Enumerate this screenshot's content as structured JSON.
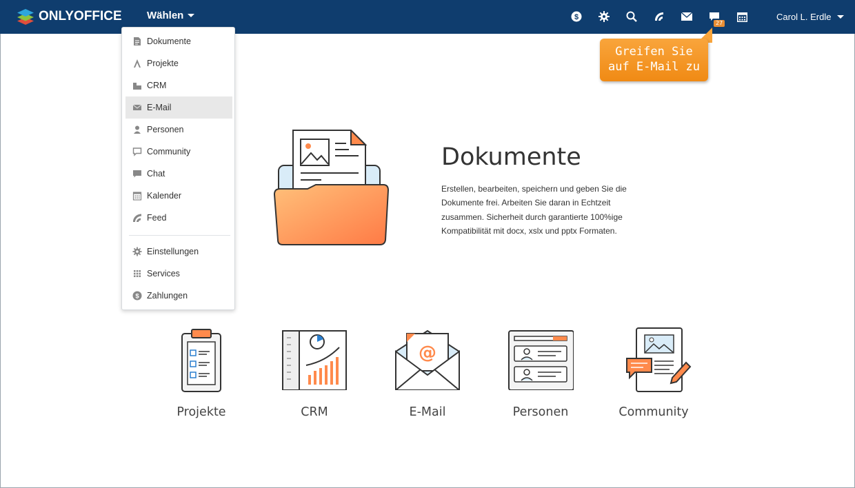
{
  "header": {
    "logo_text": "ONLYOFFICE",
    "modules_label": "Wählen",
    "icons": [
      "dollar-icon",
      "gear-icon",
      "search-icon",
      "feed-icon",
      "mail-icon",
      "chat-icon",
      "calendar-icon"
    ],
    "chat_badge": "27",
    "user_name": "Carol L. Erdle",
    "background_color": "#0f3d6e"
  },
  "dropdown": {
    "items": [
      {
        "label": "Dokumente",
        "icon": "document-icon"
      },
      {
        "label": "Projekte",
        "icon": "projects-icon"
      },
      {
        "label": "CRM",
        "icon": "crm-icon"
      },
      {
        "label": "E-Mail",
        "icon": "mail-icon",
        "active": true
      },
      {
        "label": "Personen",
        "icon": "person-icon"
      },
      {
        "label": "Community",
        "icon": "community-icon"
      },
      {
        "label": "Chat",
        "icon": "chat-icon"
      },
      {
        "label": "Kalender",
        "icon": "calendar-icon"
      },
      {
        "label": "Feed",
        "icon": "feed-icon"
      }
    ],
    "secondary_items": [
      {
        "label": "Einstellungen",
        "icon": "gear-icon"
      },
      {
        "label": "Services",
        "icon": "grid-icon"
      },
      {
        "label": "Zahlungen",
        "icon": "dollar-icon"
      }
    ]
  },
  "tooltip": {
    "line1": "Greifen Sie",
    "line2": "auf E-Mail zu",
    "color": "#f7941d"
  },
  "hero": {
    "title": "Dokumente",
    "description": "Erstellen, bearbeiten, speichern und geben Sie die Dokumente frei. Arbeiten Sie daran in Echtzeit zusammen. Sicherheit durch garantierte 100%ige Kompatibilität mit docx, xslx und pptx Formaten."
  },
  "modules": [
    {
      "label": "Projekte"
    },
    {
      "label": "CRM"
    },
    {
      "label": "E-Mail"
    },
    {
      "label": "Personen"
    },
    {
      "label": "Community"
    }
  ]
}
